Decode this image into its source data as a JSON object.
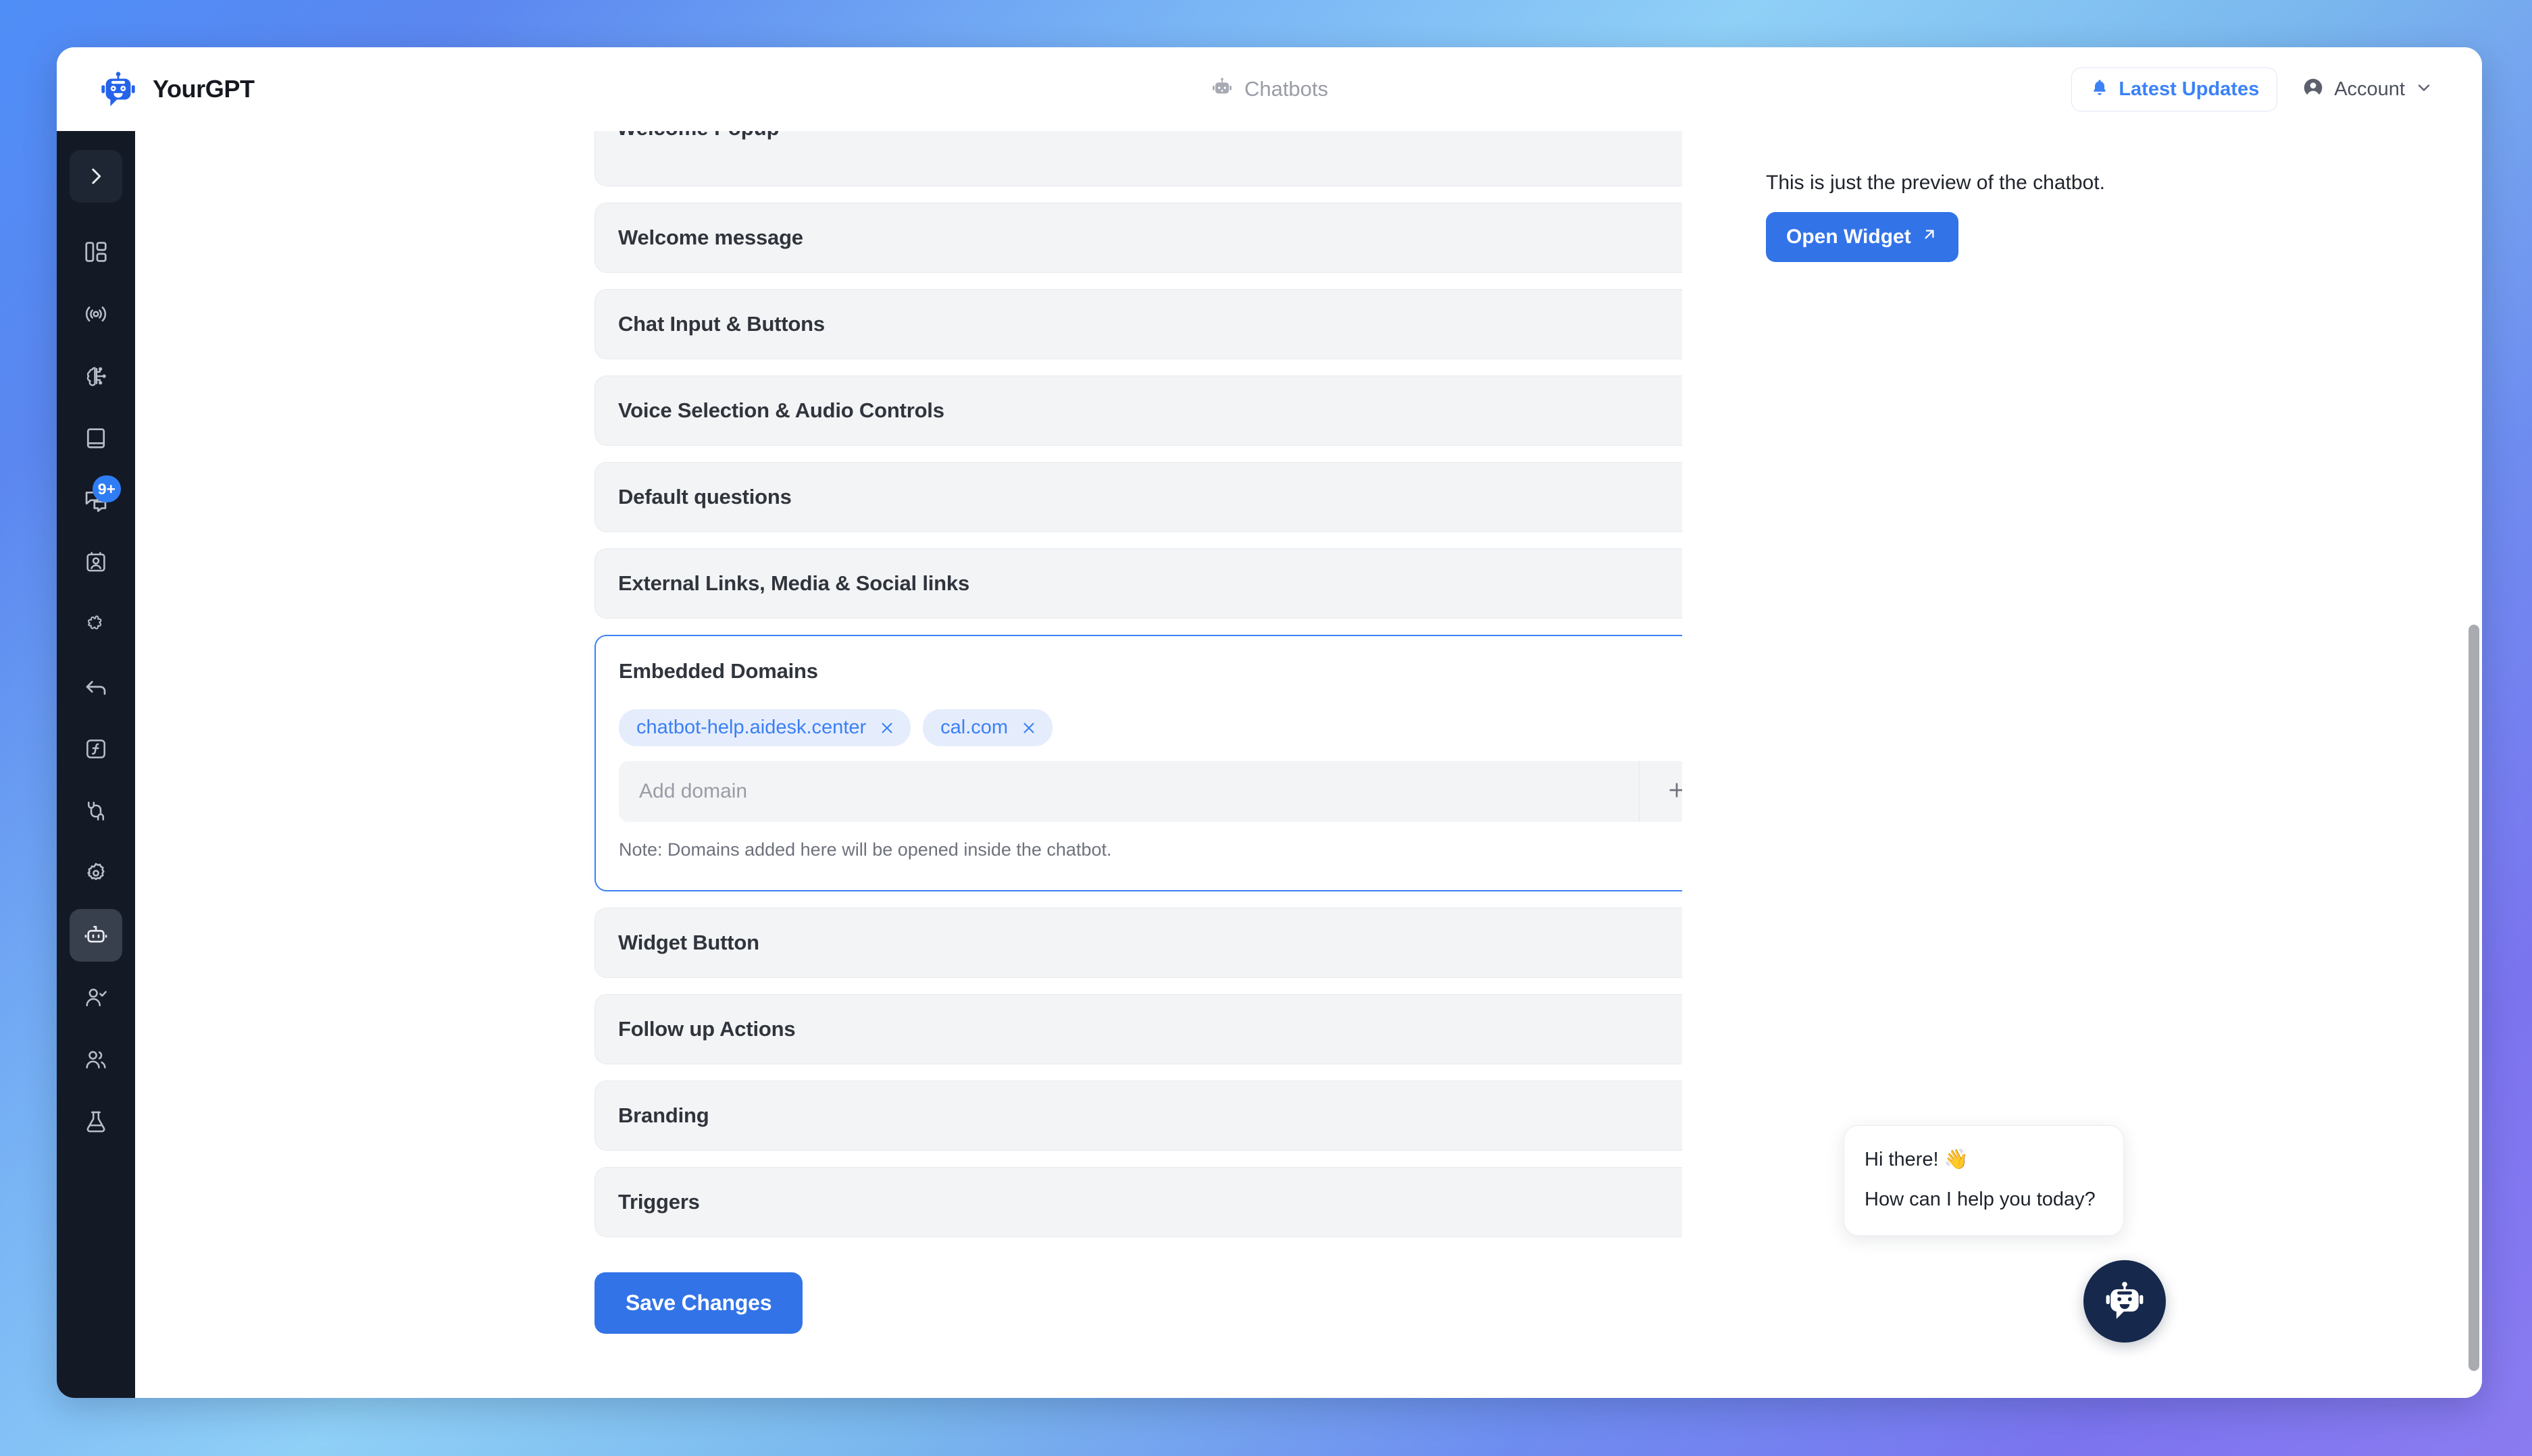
{
  "window": {
    "brand_name": "YourGPT",
    "brand_logo_icon": "robot-logo-icon"
  },
  "topbar": {
    "center_icon": "robot-icon",
    "center_label": "Chatbots",
    "updates_icon": "bell-icon",
    "updates_label": "Latest Updates",
    "account_icon": "user-circle-icon",
    "account_label": "Account",
    "account_caret_icon": "chevron-down-icon"
  },
  "sidebar": {
    "toggle": {
      "name": "expand-sidebar-toggle",
      "icon": "chevron-right-icon"
    },
    "items": [
      {
        "name": "dashboard",
        "icon": "layout-dashboard-icon",
        "active": false,
        "badge": ""
      },
      {
        "name": "broadcast",
        "icon": "broadcast-signal-icon",
        "active": false,
        "badge": ""
      },
      {
        "name": "ai-brain",
        "icon": "brain-circuit-icon",
        "active": false,
        "badge": ""
      },
      {
        "name": "knowledge-base",
        "icon": "book-icon",
        "active": false,
        "badge": ""
      },
      {
        "name": "conversations",
        "icon": "chat-bubbles-icon",
        "active": false,
        "badge": "9+"
      },
      {
        "name": "contacts",
        "icon": "contact-card-icon",
        "active": false,
        "badge": ""
      },
      {
        "name": "integrations",
        "icon": "puzzle-piece-icon",
        "active": false,
        "badge": ""
      },
      {
        "name": "back-arrow",
        "icon": "arrow-back-icon",
        "active": false,
        "badge": ""
      },
      {
        "name": "functions",
        "icon": "function-square-icon",
        "active": false,
        "badge": ""
      },
      {
        "name": "plugins",
        "icon": "plug-connect-icon",
        "active": false,
        "badge": ""
      },
      {
        "name": "settings",
        "icon": "gear-icon",
        "active": false,
        "badge": ""
      },
      {
        "name": "chatbots",
        "icon": "robot-icon",
        "active": true,
        "badge": ""
      },
      {
        "name": "agents",
        "icon": "user-check-icon",
        "active": false,
        "badge": ""
      },
      {
        "name": "team",
        "icon": "users-icon",
        "active": false,
        "badge": ""
      },
      {
        "name": "labs",
        "icon": "flask-icon",
        "active": false,
        "badge": ""
      }
    ]
  },
  "settings": {
    "partial_section_title": "Welcome Popup",
    "sections_before": [
      {
        "title": "Welcome message",
        "icon": "chevron-down-icon"
      },
      {
        "title": "Chat Input & Buttons",
        "icon": "chevron-down-icon"
      },
      {
        "title": "Voice Selection & Audio Controls",
        "icon": "chevron-down-icon"
      },
      {
        "title": "Default questions",
        "icon": "chevron-down-icon"
      },
      {
        "title": "External Links, Media & Social links",
        "icon": "chevron-down-icon"
      }
    ],
    "expanded_section": {
      "title": "Embedded Domains",
      "collapse_icon": "chevron-up-icon",
      "chips": [
        {
          "label": "chatbot-help.aidesk.center",
          "remove_icon": "close-icon"
        },
        {
          "label": "cal.com",
          "remove_icon": "close-icon"
        }
      ],
      "input_value": "",
      "input_placeholder": "Add domain",
      "add_icon": "plus-icon",
      "note": "Note: Domains added here will be opened inside the chatbot."
    },
    "sections_after": [
      {
        "title": "Widget Button",
        "icon": "chevron-down-icon"
      },
      {
        "title": "Follow up Actions",
        "icon": "chevron-down-icon"
      },
      {
        "title": "Branding",
        "icon": "chevron-down-icon"
      },
      {
        "title": "Triggers",
        "icon": "external-link-icon"
      }
    ],
    "save_label": "Save Changes"
  },
  "preview": {
    "note": "This is just the preview of the chatbot.",
    "open_widget_label": "Open Widget",
    "open_widget_icon": "arrow-up-right-icon",
    "bubble_lines": [
      "Hi there! 👋",
      "How can I help you today?"
    ],
    "launcher_icon": "robot-avatar-icon"
  },
  "colors": {
    "accent_blue": "#3273e8",
    "link_blue": "#3b7ff4",
    "chip_bg": "#e5edfd",
    "rail_bg": "#131a26",
    "card_bg": "#f3f4f6",
    "launcher_bg": "#16294c"
  }
}
